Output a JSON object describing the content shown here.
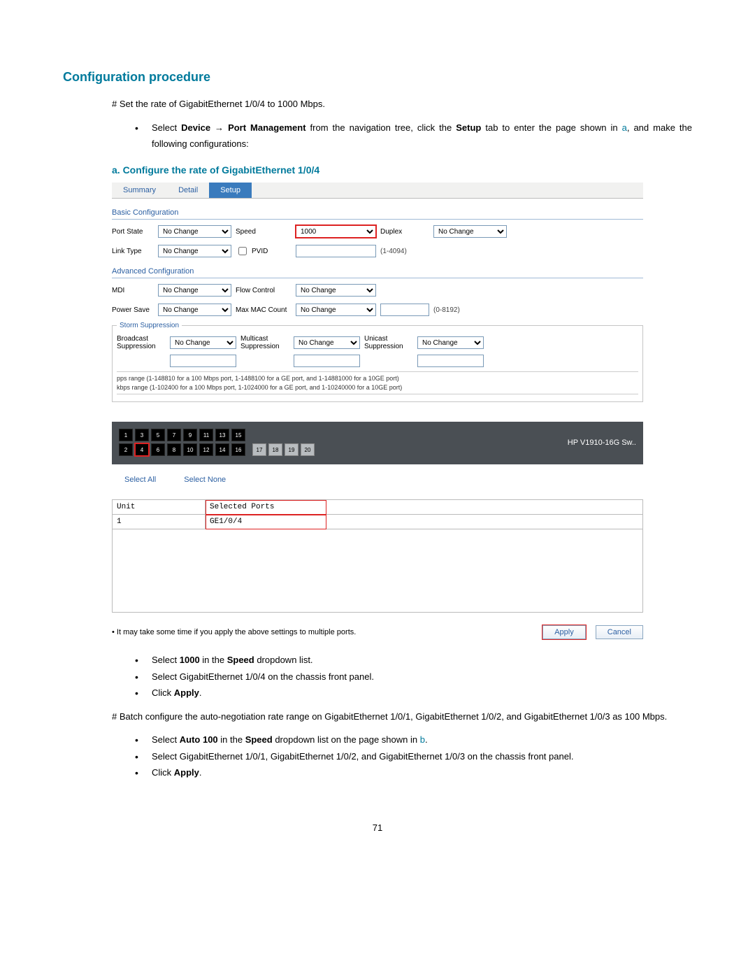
{
  "headings": {
    "config_procedure": "Configuration procedure",
    "step_a": "a.   Configure the rate of GigabitEthernet 1/0/4"
  },
  "intro": {
    "set_rate": "# Set the rate of GigabitEthernet 1/0/4 to 1000 Mbps.",
    "select_device_pre": "Select ",
    "device": "Device",
    "arrow": " → ",
    "port_mgmt": "Port Management",
    "after_nav": " from the navigation tree, click the ",
    "setup": "Setup",
    "after_setup": " tab to enter the page shown in ",
    "a_ref": "a",
    "after_a": ", and make the following configurations:"
  },
  "ui": {
    "tabs": {
      "summary": "Summary",
      "detail": "Detail",
      "setup": "Setup"
    },
    "basic": {
      "title": "Basic Configuration",
      "port_state": "Port State",
      "port_state_val": "No Change",
      "speed": "Speed",
      "speed_val": "1000",
      "duplex": "Duplex",
      "duplex_val": "No Change",
      "link_type": "Link Type",
      "link_type_val": "No Change",
      "pvid": "PVID",
      "pvid_hint": "(1-4094)"
    },
    "adv": {
      "title": "Advanced Configuration",
      "mdi": "MDI",
      "mdi_val": "No Change",
      "flow": "Flow Control",
      "flow_val": "No Change",
      "power": "Power Save",
      "power_val": "No Change",
      "maxmac": "Max MAC Count",
      "maxmac_val": "No Change",
      "maxmac_hint": "(0-8192)"
    },
    "storm": {
      "legend": "Storm Suppression",
      "broadcast": "Broadcast Suppression",
      "multicast": "Multicast Suppression",
      "unicast": "Unicast Suppression",
      "val": "No Change",
      "note1": "pps range (1-148810 for a 100 Mbps port, 1-1488100 for a GE port, and 1-14881000 for a 10GE port)",
      "note2": "kbps range (1-102400 for a 100 Mbps port, 1-1024000 for a GE port, and 1-10240000 for a 10GE port)"
    },
    "ports": {
      "device": "HP V1910-16G Sw..",
      "top": [
        "1",
        "3",
        "5",
        "7",
        "9",
        "11",
        "13",
        "15"
      ],
      "bottom": [
        "2",
        "4",
        "6",
        "8",
        "10",
        "12",
        "14",
        "16"
      ],
      "uplink": [
        "17",
        "18",
        "19",
        "20"
      ],
      "selected": "4"
    },
    "select_links": {
      "all": "Select All",
      "none": "Select None"
    },
    "table": {
      "unit_h": "Unit",
      "ports_h": "Selected Ports",
      "unit": "1",
      "ports": "GE1/0/4"
    },
    "apply_note": "It may take some time if you apply the above settings to multiple ports.",
    "apply": "Apply",
    "cancel": "Cancel"
  },
  "after_ui": {
    "b1_pre": "Select ",
    "b1_bold": "1000",
    "b1_mid": " in the ",
    "b1_bold2": "Speed",
    "b1_post": " dropdown list.",
    "b2": "Select GigabitEthernet 1/0/4 on the chassis front panel.",
    "b3_pre": "Click ",
    "b3_bold": "Apply",
    "b3_post": ".",
    "batch": "# Batch configure the auto-negotiation rate range on GigabitEthernet 1/0/1, GigabitEthernet 1/0/2, and GigabitEthernet 1/0/3 as 100 Mbps.",
    "c1_pre": "Select ",
    "c1_bold": "Auto 100",
    "c1_mid": " in the ",
    "c1_bold2": "Speed",
    "c1_post": " dropdown list on the page shown in ",
    "c1_b": "b",
    "c1_end": ".",
    "c2": "Select GigabitEthernet 1/0/1, GigabitEthernet 1/0/2, and GigabitEthernet 1/0/3 on the chassis front panel.",
    "c3_pre": "Click ",
    "c3_bold": "Apply",
    "c3_post": "."
  },
  "page_number": "71"
}
